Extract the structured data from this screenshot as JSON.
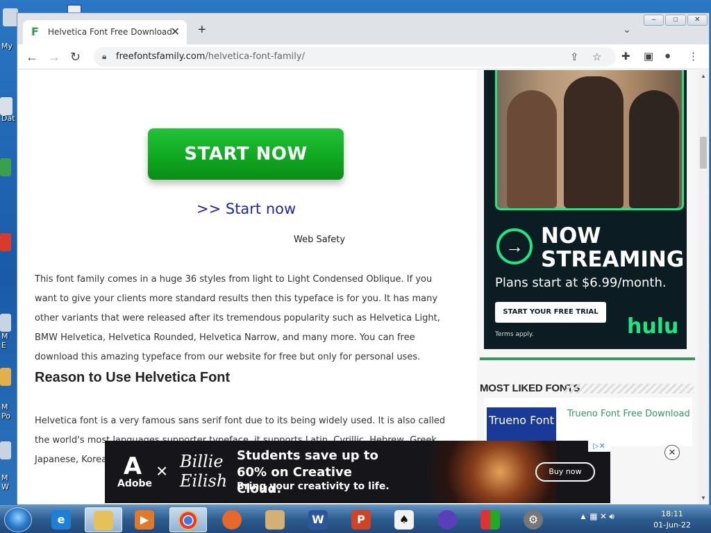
{
  "desktop": {
    "labels": [
      "My",
      "Dat",
      "M E",
      "M Po",
      "M W"
    ]
  },
  "browser": {
    "tab_title": "Helvetica Font Free Download",
    "tab_favicon": "F",
    "new_tab_label": "+",
    "url_host": "freefontsfamily.com",
    "url_path": "/helvetica-font-family/"
  },
  "page": {
    "start_button": "START NOW",
    "start_link": ">> Start now",
    "web_safety": "Web Safety",
    "paragraph_1": "This font family comes in a huge 36 styles from light to Light Condensed Oblique. If you want to give your clients more standard results then this typeface is for you. It has many other variants that were released after its tremendous popularity such as Helvetica Light, BMW Helvetica, Helvetica Rounded, Helvetica Narrow, and many more. You can free download this amazing typeface from our website for free but only for personal uses.",
    "heading": "Reason to Use Helvetica Font",
    "paragraph_2": "Helvetica font is a very famous sans serif font due to its being widely used. It is also called the world's most languages supporter typeface, it supports Latin, Cyrillic, Hebrew, Greek, Japanese, Korean, Hindi, Manufacturing likes on General in"
  },
  "sidebar": {
    "ad": {
      "now_streaming": "NOW STREAMING",
      "plans": "Plans start at $6.99/month.",
      "trial_button": "START YOUR FREE TRIAL",
      "terms": "Terms apply.",
      "brand": "hulu"
    },
    "most_liked_title": "MOST LIKED FONTS",
    "font_item": {
      "thumb_text": "Trueno Font",
      "link": "Trueno Font Free Download"
    }
  },
  "bottom_ad": {
    "brand": "Adobe",
    "partner": "Billie Eilish",
    "headline": "Students save up to 60% on Creative Cloud.",
    "sub": "Bring your creativity to life.",
    "button": "Buy now"
  },
  "taskbar": {
    "time": "18:11",
    "date": "01-Jun-22"
  },
  "colors": {
    "accent_green": "#1ce783",
    "start_green": "#13b52a",
    "link_blue": "#1a2aa0"
  }
}
